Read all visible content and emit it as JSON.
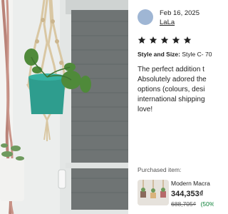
{
  "review": {
    "date": "Feb 16, 2025",
    "reviewer": "LaLa",
    "rating": 5,
    "style_label": "Style and Size:",
    "style_value": "Style C- 70",
    "text_lines": [
      "The perfect addition t",
      "Absolutely adored the",
      "options (colours, desi",
      "international shipping",
      "love!"
    ]
  },
  "purchase": {
    "label": "Purchased item:",
    "product_name": "Modern Macra",
    "price": "344,353₫",
    "original_price": "688,705₫",
    "discount": "(50%"
  },
  "icons": {
    "avatar": "user-avatar",
    "star": "star-icon"
  },
  "colors": {
    "star": "#222222",
    "avatar": "#9fb6d4",
    "discount": "#0a7f35"
  }
}
